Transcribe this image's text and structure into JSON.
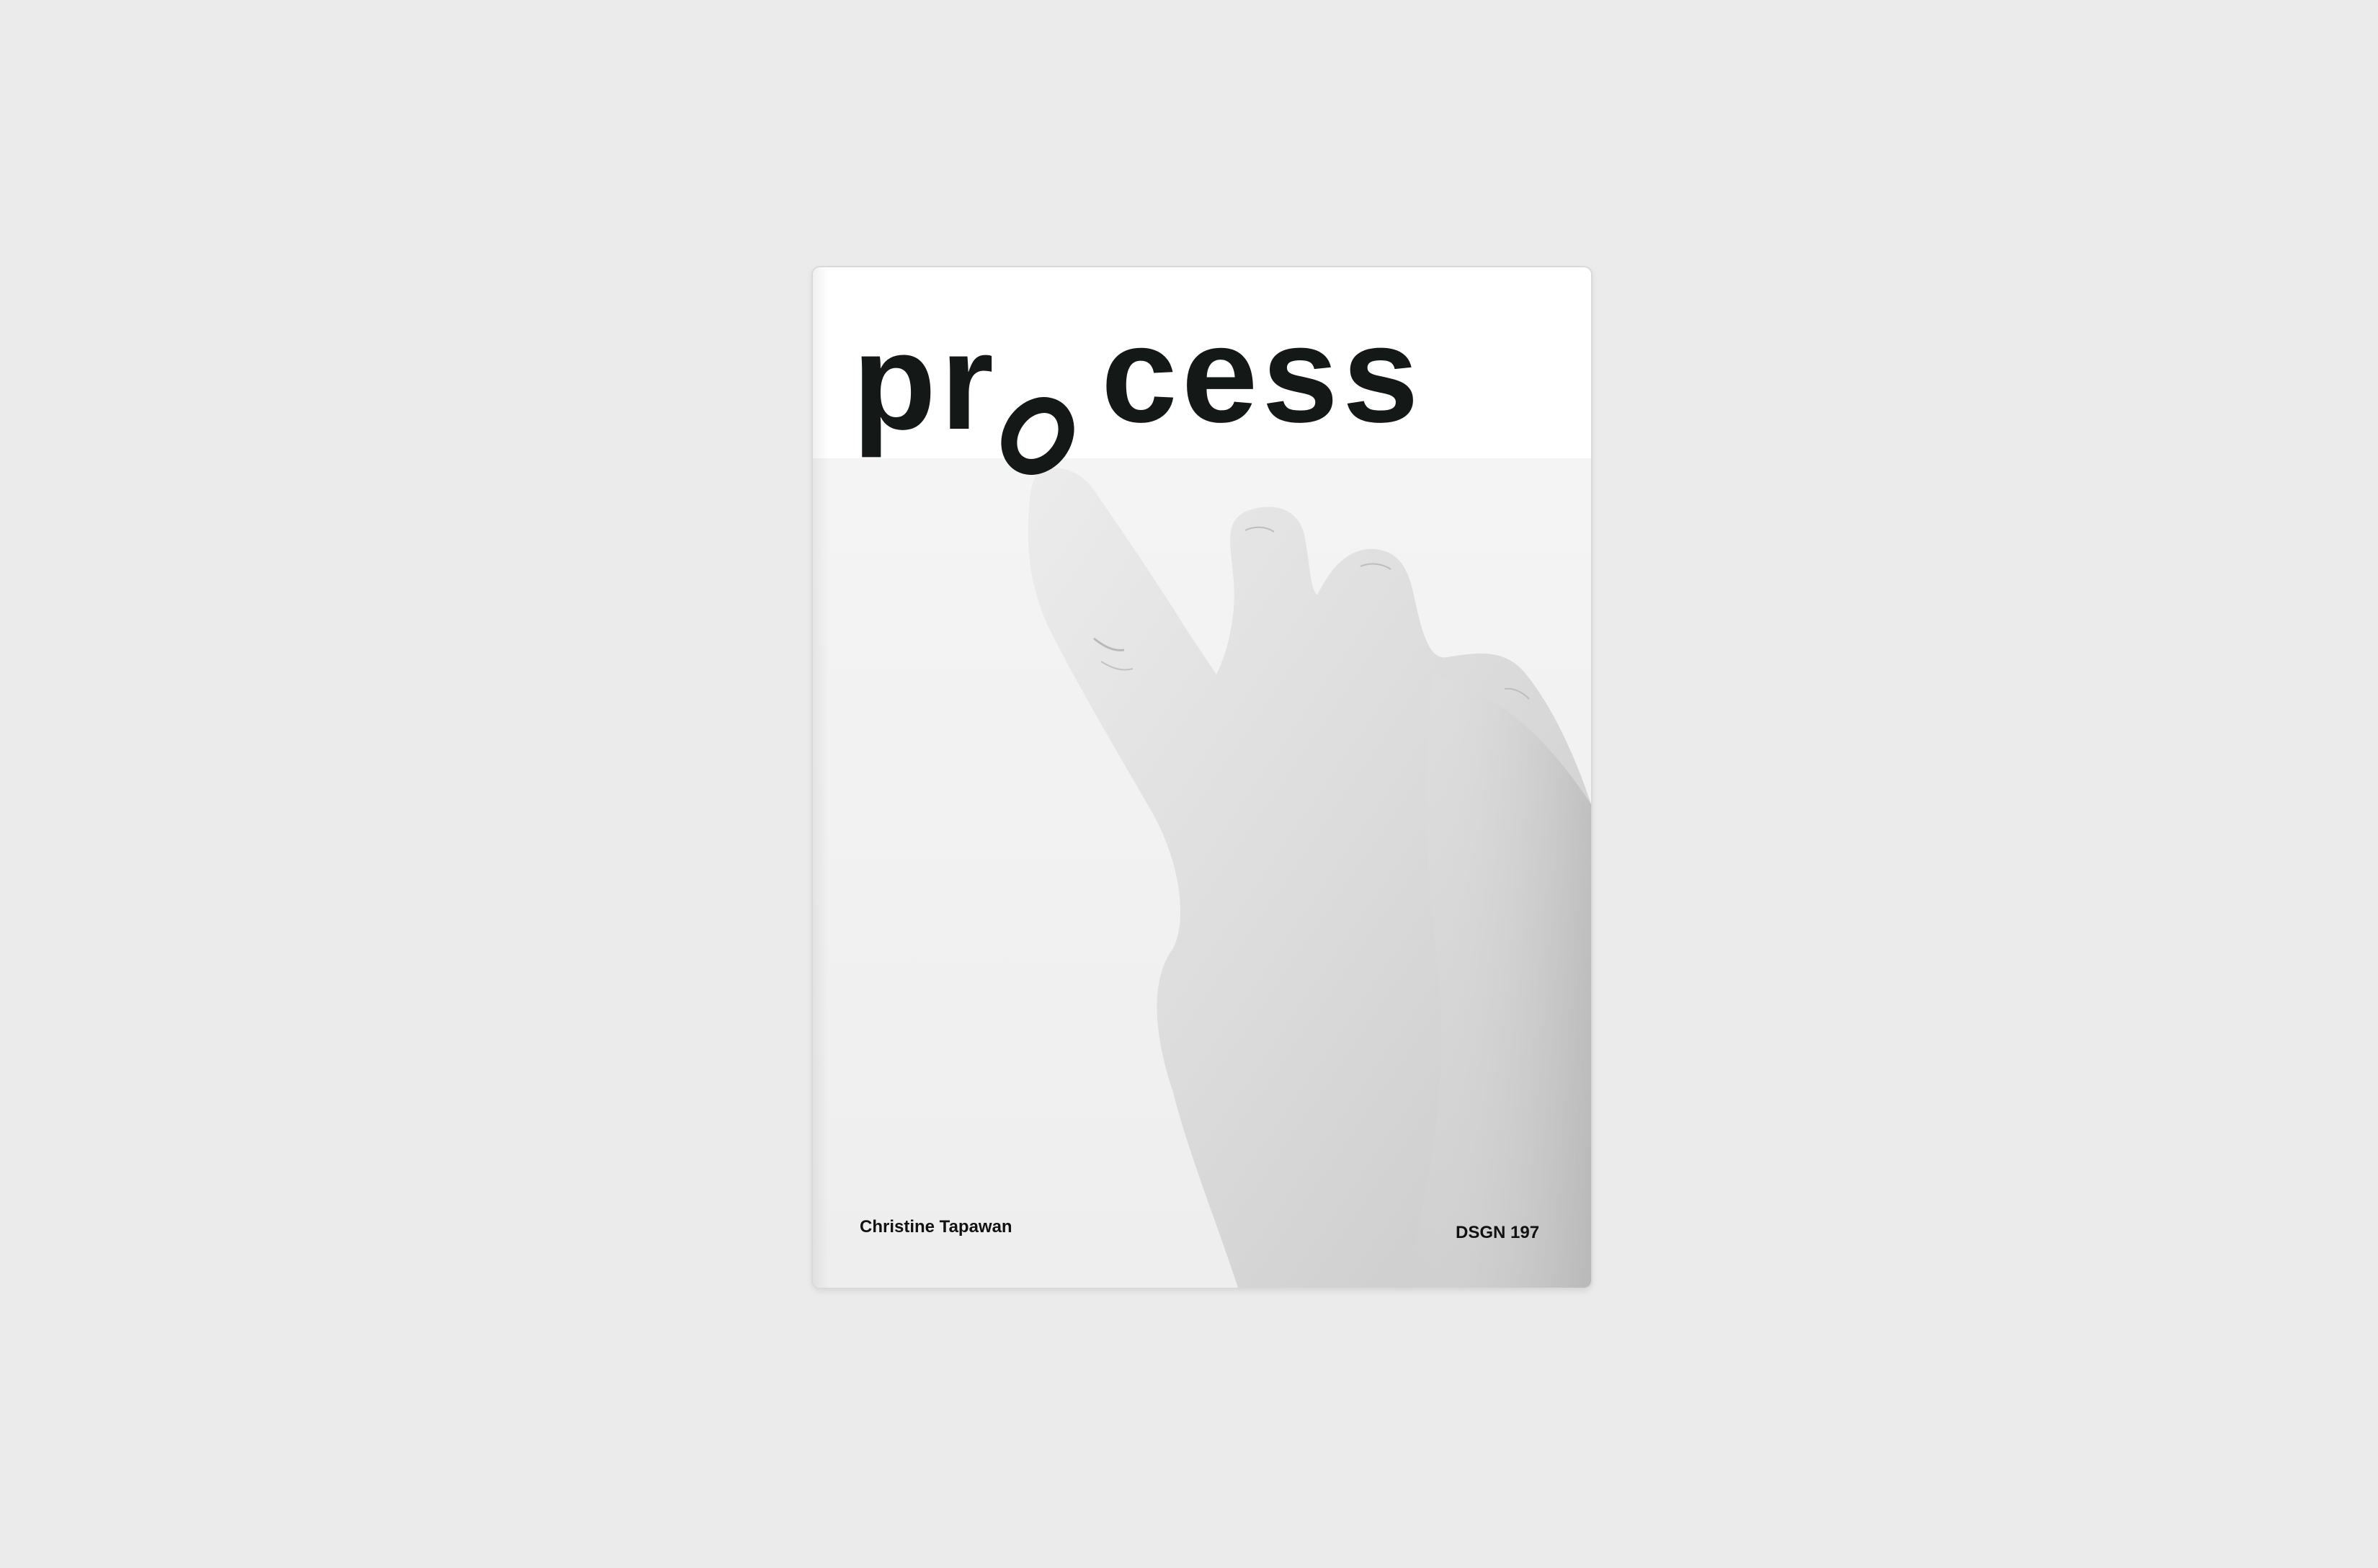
{
  "book": {
    "title_parts": [
      "pr",
      "o",
      "cess"
    ],
    "author": "Christine Tapawan",
    "course": "DSGN 197"
  },
  "colors": {
    "background": "#ebebeb",
    "cover": "#ffffff",
    "photo": "#f2f2f2",
    "text": "#141817"
  },
  "images": {
    "cover_photo": "hand-pointing-image"
  }
}
